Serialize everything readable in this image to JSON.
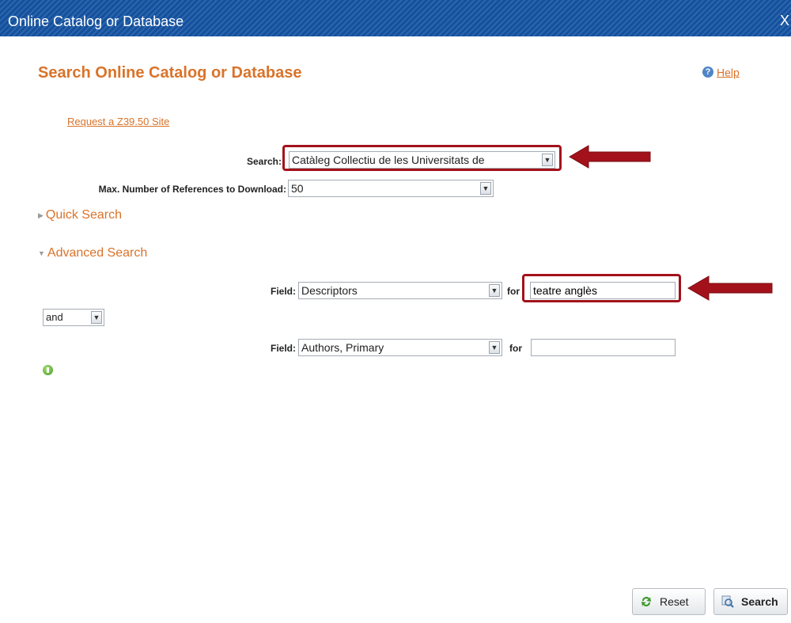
{
  "window": {
    "title": "Online Catalog or Database",
    "close_label": "X"
  },
  "page": {
    "heading": "Search Online Catalog or Database",
    "help_label": "Help",
    "request_link": "Request a Z39.50 Site"
  },
  "form": {
    "search_label": "Search:",
    "search_value": "Catàleg Collectiu de les Universitats de",
    "max_refs_label": "Max. Number of References to Download:",
    "max_refs_value": "50"
  },
  "sections": {
    "quick_search": "Quick Search",
    "advanced_search": "Advanced Search"
  },
  "advanced": {
    "rows": [
      {
        "field_label": "Field:",
        "field_value": "Descriptors",
        "for_label": "for",
        "term": "teatre anglès"
      },
      {
        "field_label": "Field:",
        "field_value": "Authors, Primary",
        "for_label": "for",
        "term": ""
      }
    ],
    "operator": "and"
  },
  "buttons": {
    "reset": "Reset",
    "search": "Search"
  },
  "colors": {
    "title_bar": "#1f5aa6",
    "accent_orange": "#d9732a",
    "highlight_red": "#a3121b"
  }
}
